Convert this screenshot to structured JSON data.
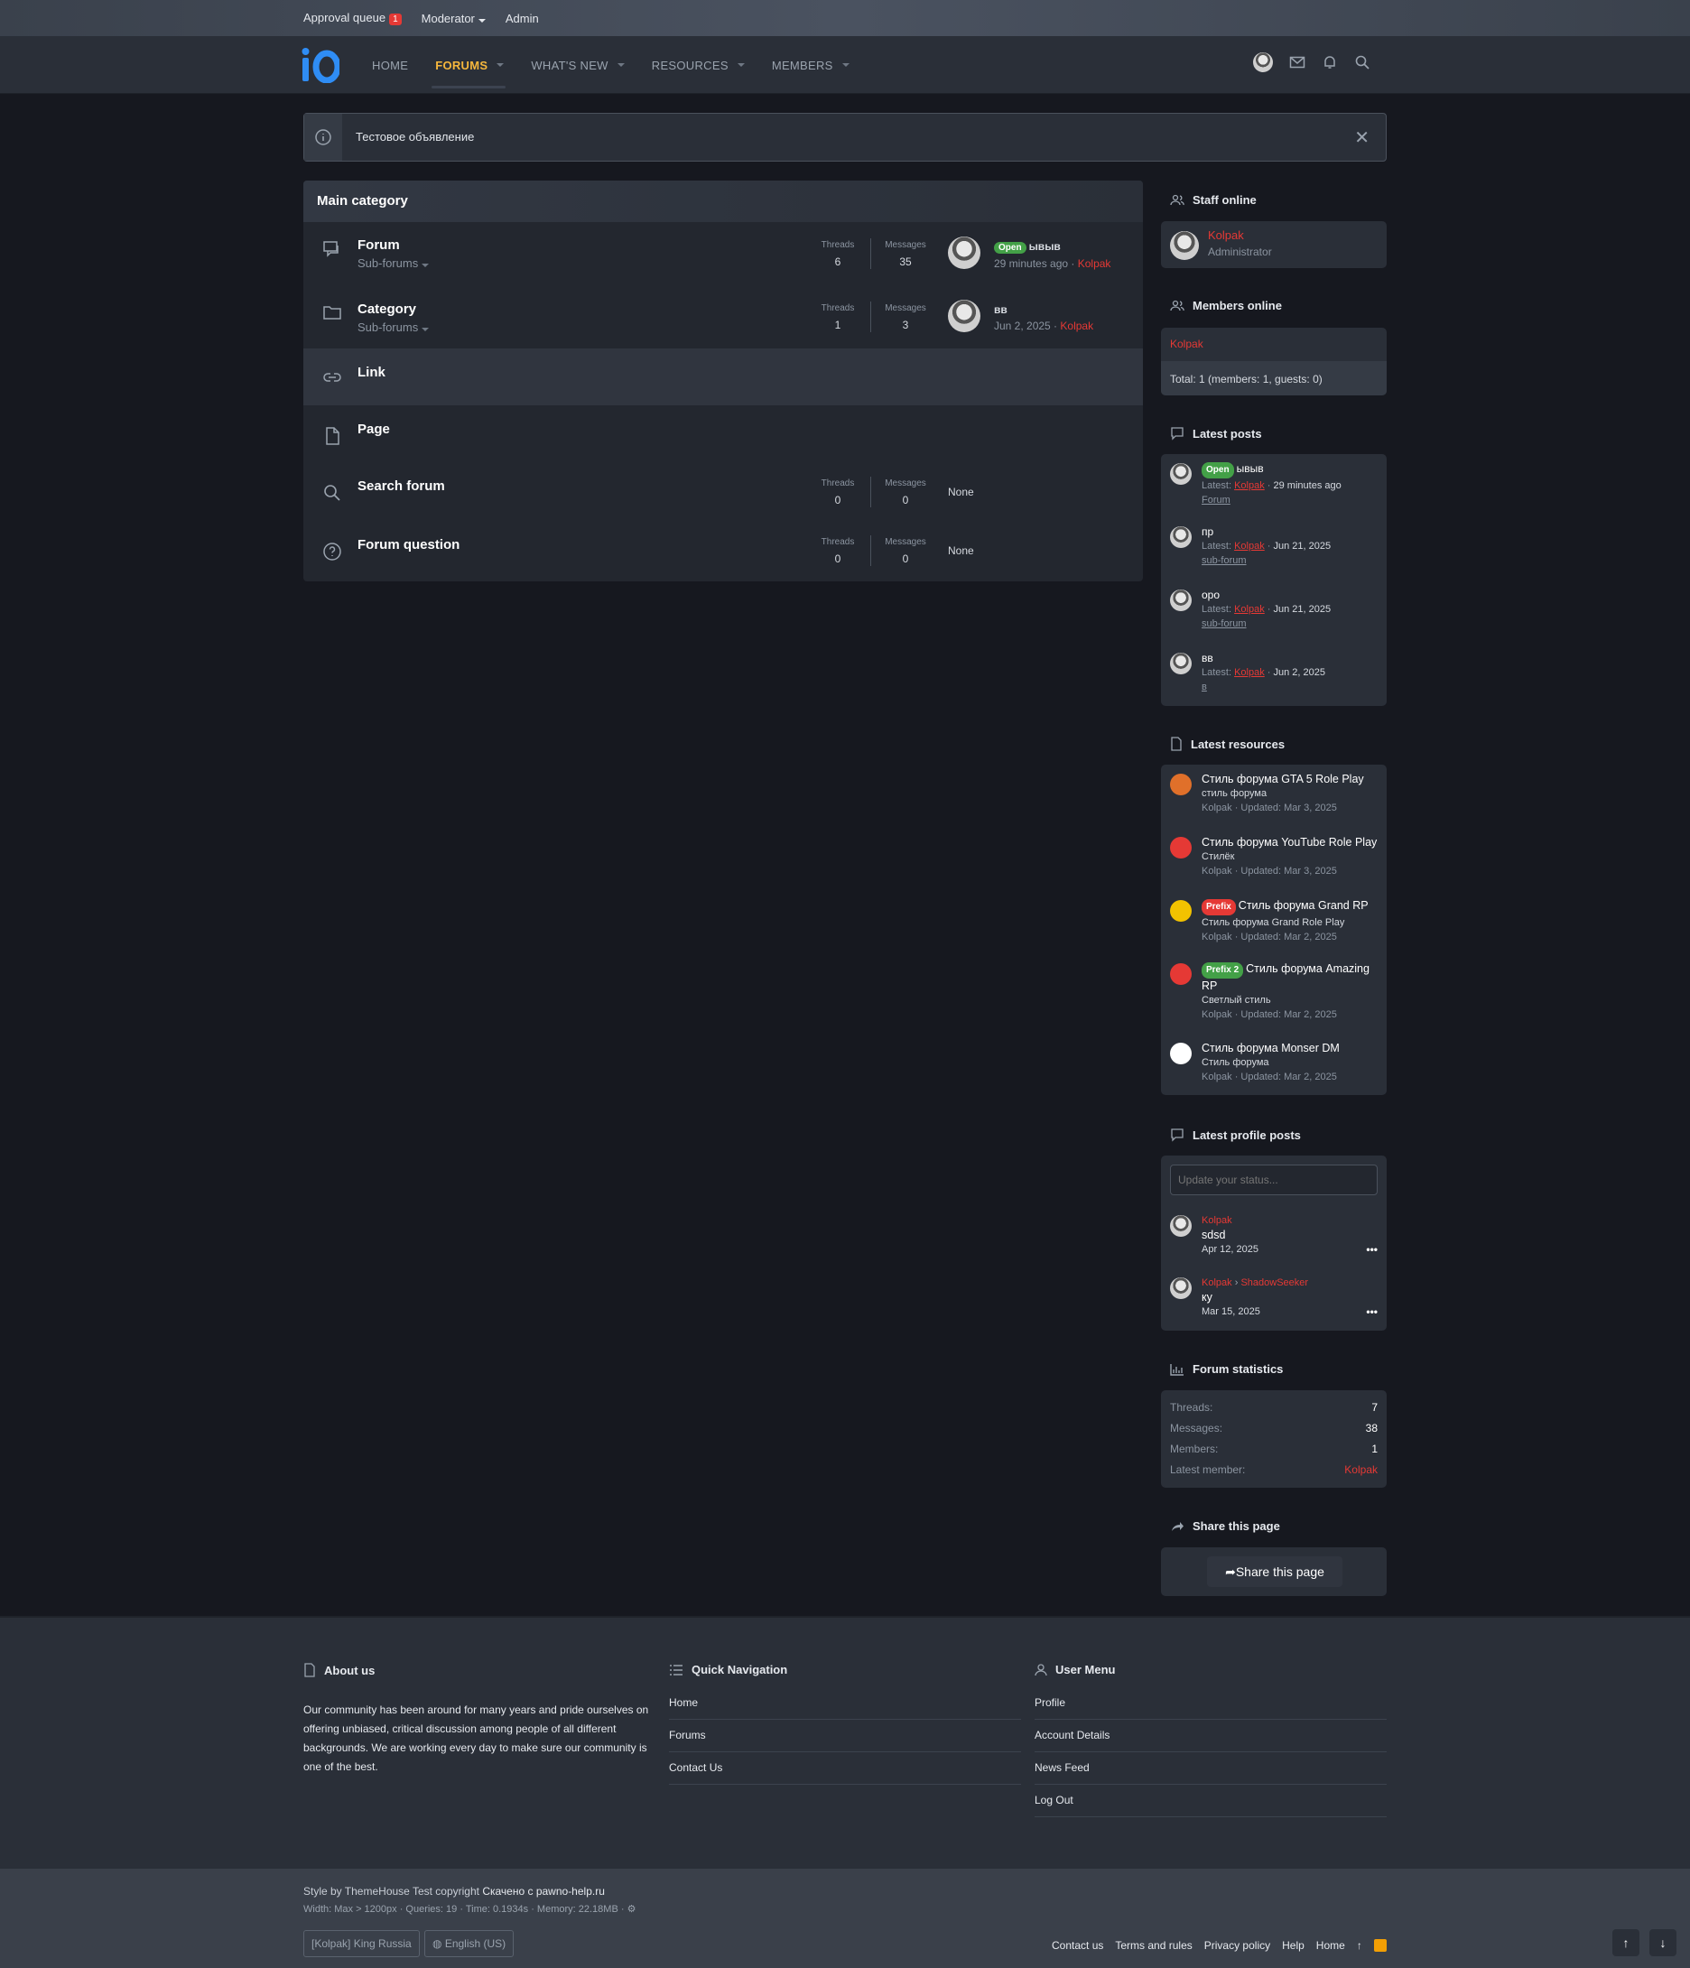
{
  "staffbar": {
    "approval_label": "Approval queue",
    "approval_count": "1",
    "moderator_label": "Moderator",
    "admin_label": "Admin"
  },
  "nav": {
    "home": "HOME",
    "forums": "FORUMS",
    "whats_new": "WHAT'S NEW",
    "resources": "RESOURCES",
    "members": "MEMBERS"
  },
  "notice": {
    "text": "Тестовое объявление",
    "close": "✕"
  },
  "main": {
    "title": "Main category",
    "nodes": [
      {
        "title": "Forum",
        "sub": "Sub-forums",
        "threads_label": "Threads",
        "threads": "6",
        "messages_label": "Messages",
        "messages": "35",
        "last_prefix": "Open",
        "last_title": "ывыв",
        "last_time": "29 minutes ago",
        "last_user": "Kolpak"
      },
      {
        "title": "Category",
        "sub": "Sub-forums",
        "threads_label": "Threads",
        "threads": "1",
        "messages_label": "Messages",
        "messages": "3",
        "last_title": "вв",
        "last_time": "Jun 2, 2025",
        "last_user": "Kolpak"
      },
      {
        "title": "Link"
      },
      {
        "title": "Page"
      },
      {
        "title": "Search forum",
        "threads_label": "Threads",
        "threads": "0",
        "messages_label": "Messages",
        "messages": "0",
        "last": "None"
      },
      {
        "title": "Forum question",
        "threads_label": "Threads",
        "threads": "0",
        "messages_label": "Messages",
        "messages": "0",
        "last": "None"
      }
    ]
  },
  "sidebar": {
    "staff": {
      "title": "Staff online",
      "user": "Kolpak",
      "role": "Administrator"
    },
    "members": {
      "title": "Members online",
      "user": "Kolpak",
      "total": "Total: 1 (members: 1, guests: 0)"
    },
    "latest_posts": {
      "title": "Latest posts",
      "items": [
        {
          "prefix": "Open",
          "title": "ывыв",
          "latest": "Latest:",
          "user": "Kolpak",
          "time": "29 minutes ago",
          "forum": "Forum"
        },
        {
          "title": "пр",
          "latest": "Latest:",
          "user": "Kolpak",
          "time": "Jun 21, 2025",
          "forum": "sub-forum"
        },
        {
          "title": "оро",
          "latest": "Latest:",
          "user": "Kolpak",
          "time": "Jun 21, 2025",
          "forum": "sub-forum"
        },
        {
          "title": "вв",
          "latest": "Latest:",
          "user": "Kolpak",
          "time": "Jun 2, 2025",
          "forum": "в"
        }
      ]
    },
    "latest_resources": {
      "title": "Latest resources",
      "items": [
        {
          "title": "Стиль форума GTA 5 Role Play",
          "desc": "стиль форума",
          "meta": "Kolpak · Updated: Mar 3, 2025",
          "color": "#e0702a"
        },
        {
          "title": "Стиль форума YouTube Role Play",
          "desc": "Стилёк",
          "meta": "Kolpak · Updated: Mar 3, 2025",
          "color": "#e53935"
        },
        {
          "prefix": "Prefix",
          "title": "Стиль форума Grand RP",
          "desc": "Стиль форума Grand Role Play",
          "meta": "Kolpak · Updated: Mar 2, 2025",
          "color": "#f2c200"
        },
        {
          "prefix": "Prefix 2",
          "title": "Стиль форума Amazing RP",
          "desc": "Светлый стиль",
          "meta": "Kolpak · Updated: Mar 2, 2025",
          "color": "#e53935"
        },
        {
          "title": "Стиль форума Monser DM",
          "desc": "Стиль форума",
          "meta": "Kolpak · Updated: Mar 2, 2025",
          "color": "#ffffff"
        }
      ]
    },
    "profile_posts": {
      "title": "Latest profile posts",
      "placeholder": "Update your status...",
      "items": [
        {
          "user": "Kolpak",
          "text": "sdsd",
          "date": "Apr 12, 2025"
        },
        {
          "user": "Kolpak",
          "target": "ShadowSeeker",
          "text": "ку",
          "date": "Mar 15, 2025"
        }
      ]
    },
    "stats": {
      "title": "Forum statistics",
      "threads_label": "Threads:",
      "threads": "7",
      "messages_label": "Messages:",
      "messages": "38",
      "members_label": "Members:",
      "members": "1",
      "latest_label": "Latest member:",
      "latest": "Kolpak"
    },
    "share": {
      "title": "Share this page",
      "button": "Share this page"
    }
  },
  "footer": {
    "about": {
      "title": "About us",
      "text": "Our community has been around for many years and pride ourselves on offering unbiased, critical discussion among people of all different backgrounds. We are working every day to make sure our community is one of the best."
    },
    "quicknav": {
      "title": "Quick Navigation",
      "links": [
        "Home",
        "Forums",
        "Contact Us"
      ]
    },
    "usermenu": {
      "title": "User Menu",
      "links": [
        "Profile",
        "Account Details",
        "News Feed",
        "Log Out"
      ]
    }
  },
  "bottom": {
    "style_prefix": "Style by ThemeHouse Test copyright",
    "style_link": "Скачено с pawno-help.ru",
    "debug": "Width: Max > 1200px · Queries: 19 · Time: 0.1934s · Memory: 22.18MB ·",
    "style_chooser": "[Kolpak] King Russia",
    "lang": "English (US)",
    "links": [
      "Contact us",
      "Terms and rules",
      "Privacy policy",
      "Help",
      "Home"
    ]
  },
  "colors": {
    "accent": "#f6b73c",
    "brand": "#2f8df5",
    "username": "#e53935",
    "open_prefix": "#43a047"
  }
}
